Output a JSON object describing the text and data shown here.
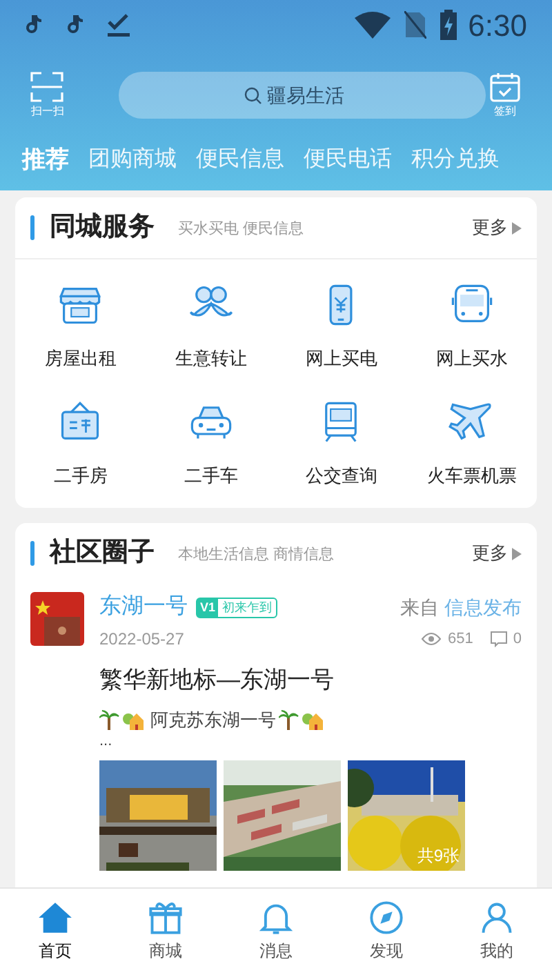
{
  "status_bar": {
    "time": "6:30"
  },
  "header": {
    "scan_label": "扫一扫",
    "search": {
      "placeholder": "疆易生活"
    },
    "checkin_label": "签到"
  },
  "tabs": [
    {
      "label": "推荐",
      "selected": true
    },
    {
      "label": "团购商城",
      "selected": false
    },
    {
      "label": "便民信息",
      "selected": false
    },
    {
      "label": "便民电话",
      "selected": false
    },
    {
      "label": "积分兑换",
      "selected": false
    }
  ],
  "city_services": {
    "title": "同城服务",
    "subtitle": "买水买电 便民信息",
    "more": "更多",
    "items": [
      {
        "label": "房屋出租"
      },
      {
        "label": "生意转让"
      },
      {
        "label": "网上买电"
      },
      {
        "label": "网上买水"
      },
      {
        "label": "二手房"
      },
      {
        "label": "二手车"
      },
      {
        "label": "公交查询"
      },
      {
        "label": "火车票机票"
      }
    ]
  },
  "community": {
    "title": "社区圈子",
    "subtitle": "本地生活信息 商情信息",
    "more": "更多",
    "post": {
      "author": "东湖一号",
      "level": "V1",
      "level_title": "初来乍到",
      "from_label": "来自",
      "source": "信息发布",
      "date": "2022-05-27",
      "views": "651",
      "comments": "0",
      "title": "繁华新地标—东湖一号",
      "excerpt": "阿克苏东湖一号",
      "ellipsis": "...",
      "photo_count": "共9张"
    }
  },
  "bottom_nav": [
    {
      "label": "首页",
      "selected": true
    },
    {
      "label": "商城",
      "selected": false
    },
    {
      "label": "消息",
      "selected": false
    },
    {
      "label": "发现",
      "selected": false
    },
    {
      "label": "我的",
      "selected": false
    }
  ]
}
